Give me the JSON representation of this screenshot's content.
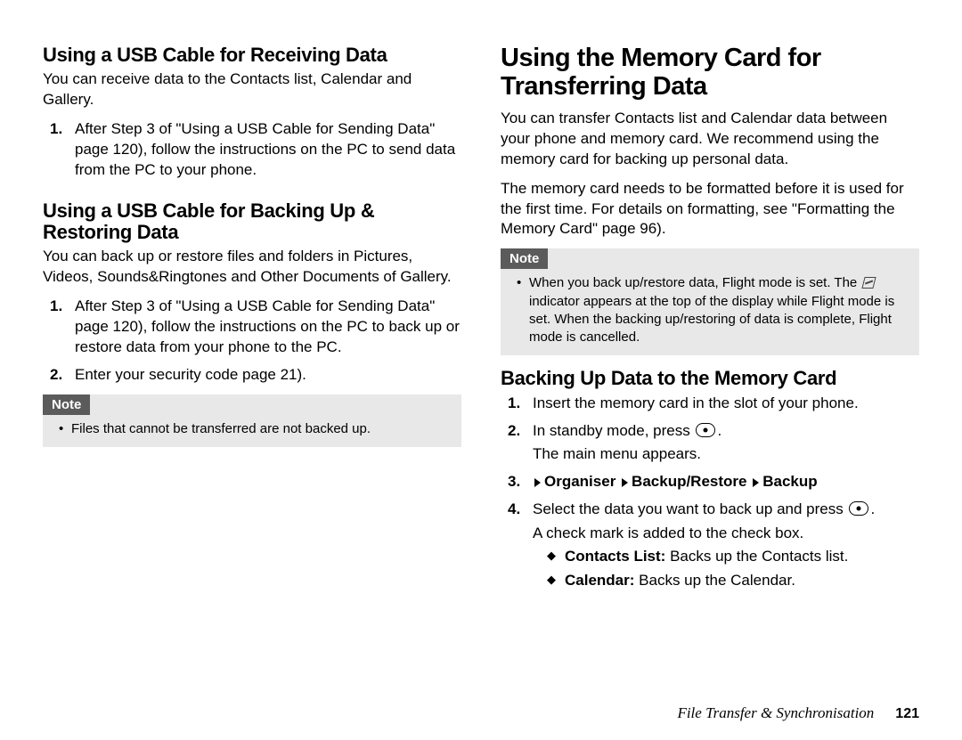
{
  "left": {
    "h2a": "Using a USB Cable for Receiving Data",
    "p1": "You can receive data to the Contacts list, Calendar and Gallery.",
    "steps_a": [
      "After Step 3 of \"Using a USB Cable for Sending Data\" page 120), follow the instructions on the PC to send data from the PC to your phone."
    ],
    "h2b": "Using a USB Cable for Backing Up & Restoring Data",
    "p2": "You can back up or restore files and folders in Pictures, Videos, Sounds&Ringtones and Other Documents of Gallery.",
    "steps_b": [
      "After Step 3 of \"Using a USB Cable for Sending Data\" page 120), follow the instructions on the PC to back up or restore data from your phone to the PC.",
      "Enter your security code page 21)."
    ],
    "note_label": "Note",
    "note_items": [
      "Files that cannot be transferred are not backed up."
    ]
  },
  "right": {
    "h1": "Using the Memory Card for Transferring Data",
    "p1": "You can transfer Contacts list and Calendar data between your phone and memory card. We recommend using the memory card for backing up personal data.",
    "p2": "The memory card needs to be formatted before it is used for the first time. For details on formatting, see \"Formatting the Memory Card\" page 96).",
    "note_label": "Note",
    "note_pre": "When you back up/restore data, Flight mode is set. The ",
    "note_post": " indicator appears at the top of the display while Flight mode is set. When the backing up/restoring of data is complete, Flight mode is cancelled.",
    "h2": "Backing Up Data to the Memory Card",
    "step1": "Insert the memory card in the slot of your phone.",
    "step2_pre": "In standby mode, press ",
    "step2_post": ".",
    "step2_extra": "The main menu appears.",
    "step3_nav1": "Organiser",
    "step3_nav2": "Backup/Restore",
    "step3_nav3": "Backup",
    "step4_pre": "Select the data you want to back up and press ",
    "step4_post": ".",
    "step4_extra": "A check mark is added to the check box.",
    "bullets": [
      {
        "label": "Contacts List:",
        "text": " Backs up the Contacts list."
      },
      {
        "label": "Calendar:",
        "text": " Backs up the Calendar."
      }
    ]
  },
  "footer": {
    "section": "File Transfer & Synchronisation",
    "page": "121"
  }
}
